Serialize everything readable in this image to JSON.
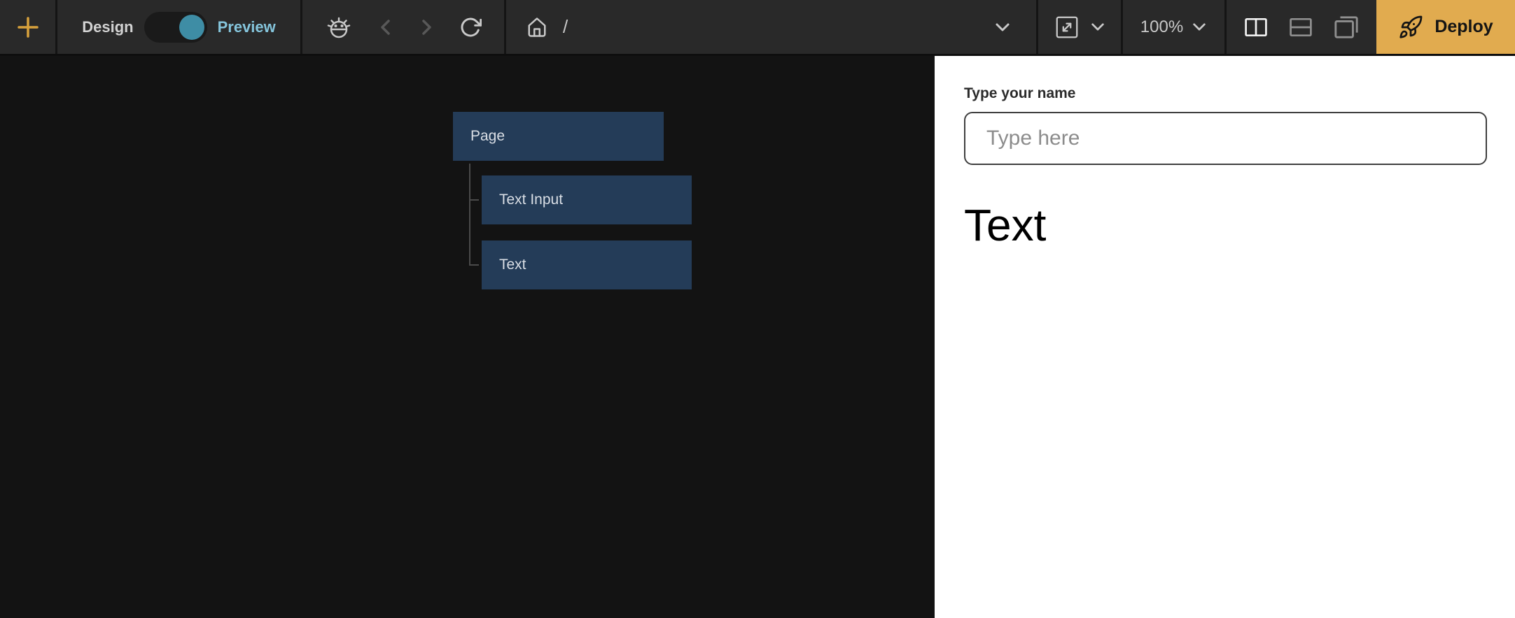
{
  "toolbar": {
    "add_label": "+",
    "design_label": "Design",
    "preview_label": "Preview",
    "mode_state": "Preview",
    "path": "/",
    "zoom_level": "100%",
    "deploy_label": "Deploy",
    "icons": [
      "plus-icon",
      "bug-icon",
      "chevron-left-icon",
      "chevron-right-icon",
      "refresh-icon",
      "home-icon",
      "chevron-down-icon",
      "fullscreen-icon",
      "columns-layout-icon",
      "rows-layout-icon",
      "floating-window-icon",
      "rocket-icon"
    ]
  },
  "tree": {
    "nodes": [
      {
        "label": "Page"
      },
      {
        "label": "Text Input"
      },
      {
        "label": "Text"
      }
    ]
  },
  "preview": {
    "name_label": "Type your name",
    "input_value": "",
    "input_placeholder": "Type here",
    "text_content": "Text"
  },
  "colors": {
    "toolbar_bg": "#292929",
    "canvas_bg": "#131313",
    "deploy_yellow": "#e1ab4f",
    "plus_orange": "#d7a13c",
    "preview_blue": "#85c5dc",
    "toggle_knob_teal": "#3e8da5",
    "tree_node_navy": "#243c58",
    "panel_white": "#ffffff"
  }
}
